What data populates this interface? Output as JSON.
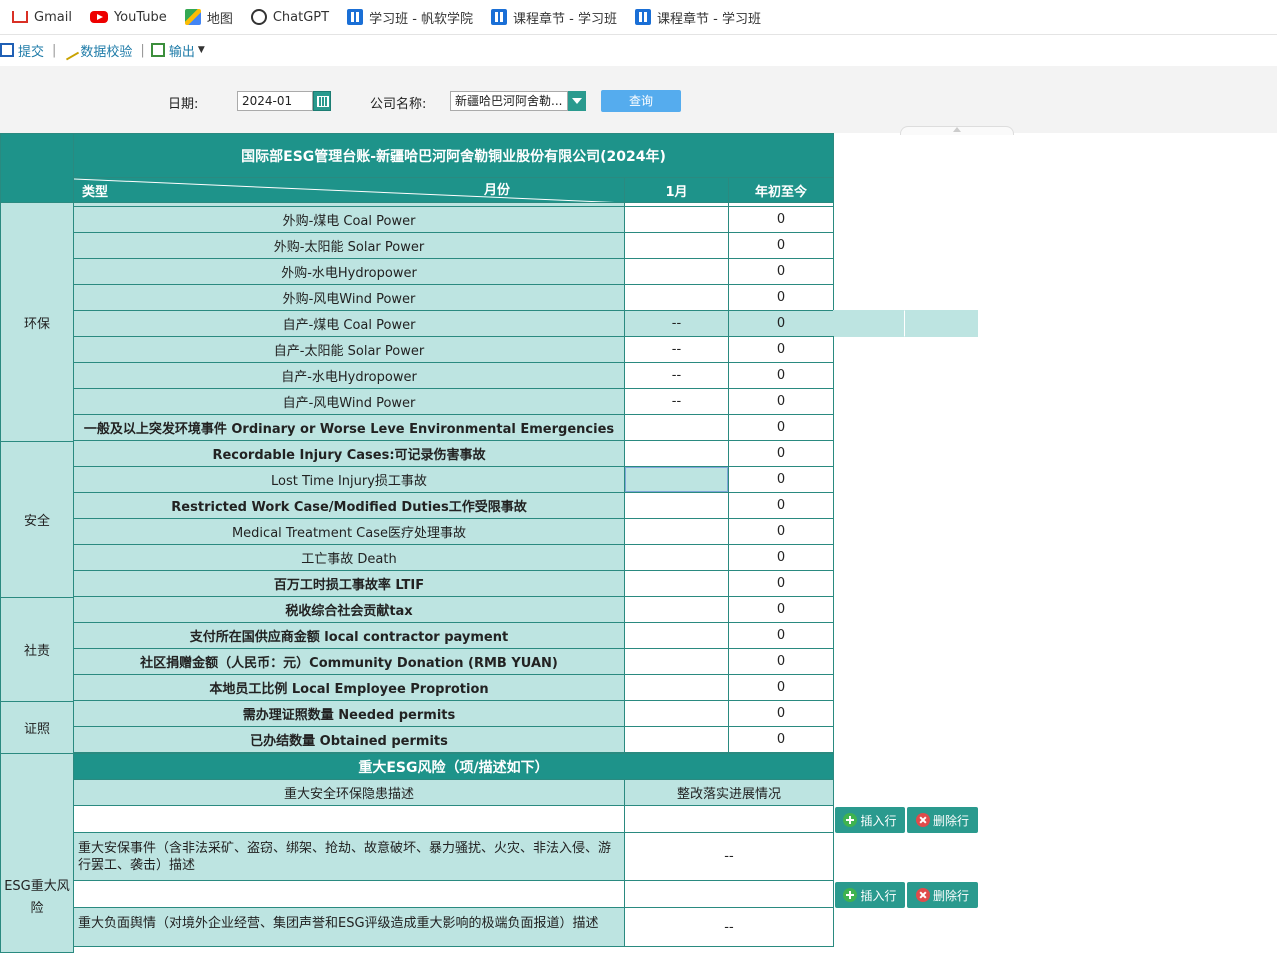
{
  "bookmarks": [
    {
      "label": "Gmail",
      "icon": "gmail-icon"
    },
    {
      "label": "YouTube",
      "icon": "youtube-icon"
    },
    {
      "label": "地图",
      "icon": "maps-icon"
    },
    {
      "label": "ChatGPT",
      "icon": "chatgpt-icon"
    },
    {
      "label": "学习班 - 帆软学院",
      "icon": "fanruan-icon"
    },
    {
      "label": "课程章节 - 学习班",
      "icon": "fanruan-icon"
    },
    {
      "label": "课程章节 - 学习班",
      "icon": "fanruan-icon"
    }
  ],
  "toolbar": {
    "submit": "提交",
    "validate": "数据校验",
    "export": "输出"
  },
  "form": {
    "date_label": "日期:",
    "date_value": "2024-01",
    "company_label": "公司名称:",
    "company_value": "新疆哈巴河阿舍勒...",
    "query_label": "查询"
  },
  "table": {
    "title": "国际部ESG管理台账-新疆哈巴河阿舍勒铜业股份有限公司(2024年)",
    "corner_type": "类型",
    "corner_month": "月份",
    "col_month": "1月",
    "col_ytd": "年初至今",
    "groups": {
      "env": "环保",
      "safety": "安全",
      "social": "社责",
      "permit": "证照",
      "risk": "ESG重大风险"
    },
    "rows": [
      {
        "label": "外购-煤电 Coal Power",
        "month": "",
        "ytd": "0"
      },
      {
        "label": "外购-太阳能 Solar Power",
        "month": "",
        "ytd": "0"
      },
      {
        "label": "外购-水电Hydropower",
        "month": "",
        "ytd": "0"
      },
      {
        "label": "外购-风电Wind Power",
        "month": "",
        "ytd": "0"
      },
      {
        "label": "自产-煤电 Coal Power",
        "month": "--",
        "ytd": "0"
      },
      {
        "label": "自产-太阳能 Solar Power",
        "month": "--",
        "ytd": "0"
      },
      {
        "label": "自产-水电Hydropower",
        "month": "--",
        "ytd": "0"
      },
      {
        "label": "自产-风电Wind Power",
        "month": "--",
        "ytd": "0"
      },
      {
        "label": "一般及以上突发环境事件 Ordinary or Worse Leve Environmental Emergencies",
        "month": "",
        "ytd": "0"
      },
      {
        "label": "Recordable Injury Cases:可记录伤害事故",
        "month": "",
        "ytd": "0"
      },
      {
        "label": "Lost Time Injury损工事故",
        "month": "",
        "ytd": "0"
      },
      {
        "label": "Restricted Work Case/Modified Duties工作受限事故",
        "month": "",
        "ytd": "0"
      },
      {
        "label": "Medical Treatment Case医疗处理事故",
        "month": "",
        "ytd": "0"
      },
      {
        "label": "工亡事故 Death",
        "month": "",
        "ytd": "0"
      },
      {
        "label": "百万工时损工事故率 LTIF",
        "month": "",
        "ytd": "0"
      },
      {
        "label": "税收综合社会贡献tax",
        "month": "",
        "ytd": "0"
      },
      {
        "label": "支付所在国供应商金额 local contractor payment",
        "month": "",
        "ytd": "0"
      },
      {
        "label": "社区捐赠金额（人民币：元）Community Donation (RMB YUAN)",
        "month": "",
        "ytd": "0"
      },
      {
        "label": "本地员工比例 Local Employee Proprotion",
        "month": "",
        "ytd": "0"
      },
      {
        "label": "需办理证照数量 Needed permits",
        "month": "",
        "ytd": "0"
      },
      {
        "label": "已办结数量 Obtained permits",
        "month": "",
        "ytd": "0"
      }
    ],
    "risk_header": "重大ESG风险（项/描述如下）",
    "risk_col_desc": "重大安全环保隐患描述",
    "risk_col_progress": "整改落实进展情况",
    "risk_items": [
      {
        "desc": "重大安保事件（含非法采矿、盗窃、绑架、抢劫、故意破坏、暴力骚扰、火灾、非法入侵、游行罢工、袭击）描述",
        "progress": "--"
      },
      {
        "desc": "重大负面舆情（对境外企业经营、集团声誉和ESG评级造成重大影响的极端负面报道）描述",
        "progress": "--"
      }
    ],
    "insert_label": "插入行",
    "delete_label": "删除行"
  }
}
